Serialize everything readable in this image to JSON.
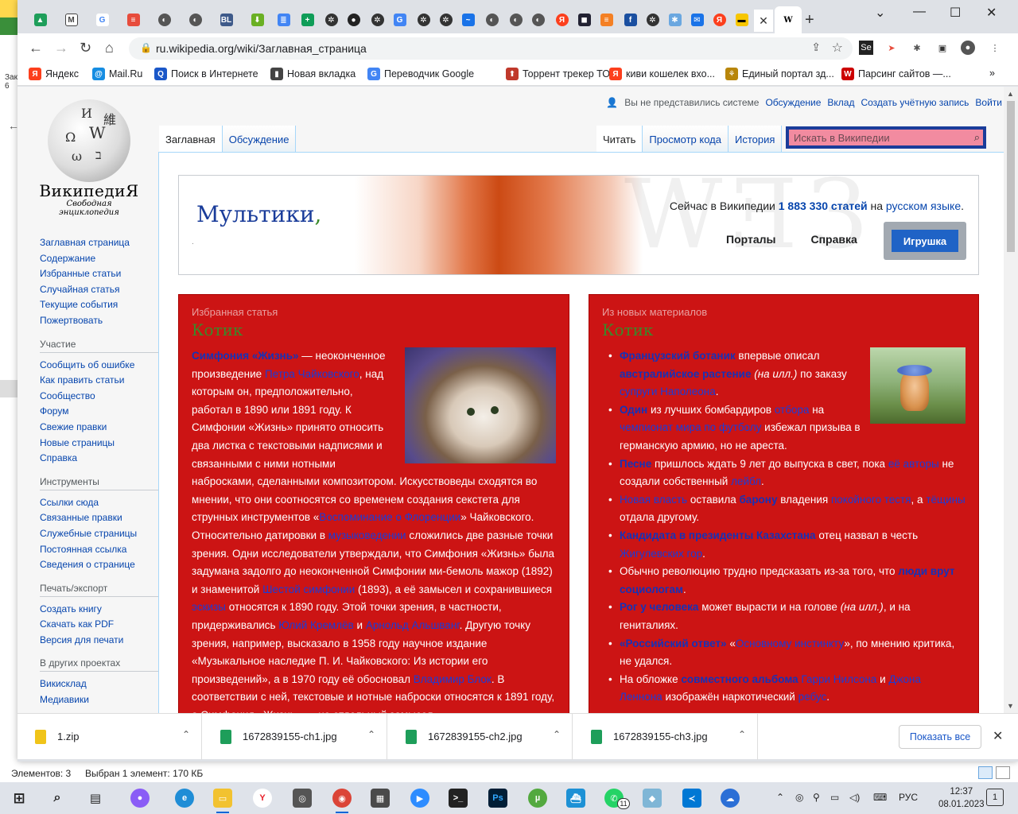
{
  "explorer": {
    "left_text": "Зак\n6",
    "status_items": "Элементов: 3",
    "status_selected": "Выбран 1 элемент: 170 КБ"
  },
  "browser": {
    "url": "ru.wikipedia.org/wiki/Заглавная_страница",
    "tab_w_label": "W",
    "bookmarks": [
      {
        "label": "Яндекс",
        "icon": "yandex-icon",
        "color": "#fc3f1d"
      },
      {
        "label": "Mail.Ru",
        "icon": "mailru-icon",
        "color": "#168de2"
      },
      {
        "label": "Поиск в Интернете",
        "icon": "search-icon",
        "color": "#1a57c8"
      },
      {
        "label": "Новая вкладка",
        "icon": "bookmark-icon",
        "color": "#444"
      },
      {
        "label": "Переводчик Google",
        "icon": "translate-icon",
        "color": "#4285f4"
      },
      {
        "label": "Торрент трекер ТО...",
        "icon": "torrent-icon",
        "color": "#c0392b"
      },
      {
        "label": "киви кошелек вхо...",
        "icon": "yandex-search-icon",
        "color": "#fc3f1d"
      },
      {
        "label": "Единый портал зд...",
        "icon": "gov-icon",
        "color": "#b8860b"
      },
      {
        "label": "Парсинг сайтов —...",
        "icon": "w-icon",
        "color": "#c00"
      }
    ]
  },
  "wiki": {
    "wordmark": "ВикипедиЯ",
    "tagline": "Свободная энциклопедия",
    "personal": {
      "user": "Вы не представились системе",
      "talk": "Обсуждение",
      "contrib": "Вклад",
      "create": "Создать учётную запись",
      "login": "Войти"
    },
    "tabs": {
      "main": "Заглавная",
      "discussion": "Обсуждение",
      "read": "Читать",
      "source": "Просмотр кода",
      "history": "История"
    },
    "search_placeholder": "Искать в Википедии",
    "sidebar": {
      "nav": [
        "Заглавная страница",
        "Содержание",
        "Избранные статьи",
        "Случайная статья",
        "Текущие события",
        "Пожертвовать"
      ],
      "participation_h": "Участие",
      "participation": [
        "Сообщить об ошибке",
        "Как править статьи",
        "Сообщество",
        "Форум",
        "Свежие правки",
        "Новые страницы",
        "Справка"
      ],
      "tools_h": "Инструменты",
      "tools": [
        "Ссылки сюда",
        "Связанные правки",
        "Служебные страницы",
        "Постоянная ссылка",
        "Сведения о странице"
      ],
      "print_h": "Печать/экспорт",
      "print": [
        "Создать книгу",
        "Скачать как PDF",
        "Версия для печати"
      ],
      "other_h": "В других проектах",
      "other": [
        "Викисклад",
        "Медиавики"
      ]
    },
    "banner": {
      "title": "Мультики",
      "comma": ",",
      "dot": ".",
      "stats_prefix": "Сейчас в Википедии",
      "stats_count": "1 883 330 статей",
      "stats_on": "на",
      "stats_lang": "русском языке",
      "stats_end": ".",
      "portals": "Порталы",
      "help": "Справка",
      "toy": "Игрушка"
    },
    "featured": {
      "heading": "Избранная статья",
      "subtitle": "Котик"
    },
    "news": {
      "heading": "Из новых материалов",
      "subtitle": "Котик"
    }
  },
  "downloads": {
    "items": [
      "1.zip",
      "1672839155-ch1.jpg",
      "1672839155-ch2.jpg",
      "1672839155-ch3.jpg"
    ],
    "show_all": "Показать все"
  },
  "taskbar": {
    "lang": "РУС",
    "time": "12:37",
    "date": "08.01.2023",
    "notifications": "1",
    "whatsapp_badge": "11"
  }
}
